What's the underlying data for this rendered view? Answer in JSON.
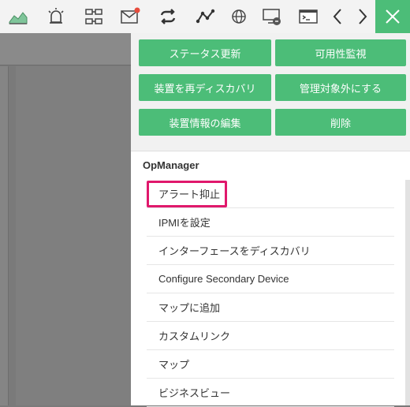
{
  "toolbar": {
    "icons": [
      "chart-icon",
      "alarm-icon",
      "topology-icon",
      "mail-icon",
      "sync-icon",
      "graph-icon",
      "globe-icon",
      "remote-desktop-icon",
      "terminal-icon",
      "prev-icon",
      "next-icon",
      "close-icon"
    ]
  },
  "actions": {
    "status_update": "ステータス更新",
    "availability_monitor": "可用性監視",
    "rediscover": "装置を再ディスカバリ",
    "unmanage": "管理対象外にする",
    "edit_info": "装置情報の編集",
    "delete": "削除"
  },
  "section_title": "OpManager",
  "menu": [
    "アラート抑止",
    "IPMIを設定",
    "インターフェースをディスカバリ",
    "Configure Secondary Device",
    "マップに追加",
    "カスタムリンク",
    "マップ",
    "ビジネスビュー"
  ],
  "colors": {
    "accent": "#4cbd78",
    "highlight": "#e0186c",
    "overlay": "#7a7a7a"
  }
}
